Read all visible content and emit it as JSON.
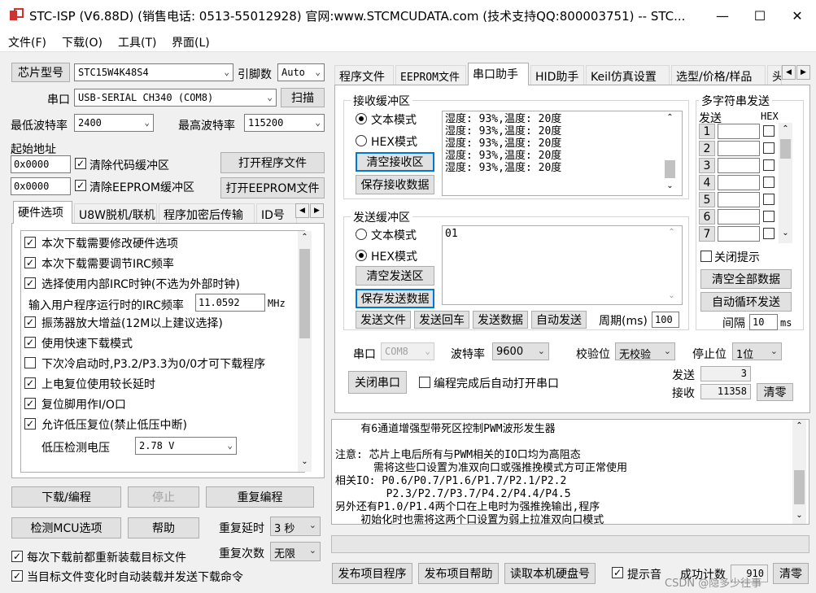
{
  "window": {
    "title": "STC-ISP (V6.88D) (销售电话: 0513-55012928) 官网:www.STCMCUDATA.com  (技术支持QQ:800003751) -- STC...",
    "minimize": "—",
    "maximize": "☐",
    "close": "✕"
  },
  "menu": [
    "文件(F)",
    "下载(O)",
    "工具(T)",
    "界面(L)"
  ],
  "left": {
    "chip_btn": "芯片型号",
    "chip_value": "STC15W4K48S4",
    "pins_label": "引脚数",
    "pins_value": "Auto",
    "port_label": "串口",
    "port_value": "USB-SERIAL CH340 (COM8)",
    "scan_btn": "扫描",
    "min_baud_label": "最低波特率",
    "min_baud_value": "2400",
    "max_baud_label": "最高波特率",
    "max_baud_value": "115200",
    "start_addr_label": "起始地址",
    "addr1": "0x0000",
    "clear_code": "清除代码缓冲区",
    "open_prog": "打开程序文件",
    "addr2": "0x0000",
    "clear_eeprom": "清除EEPROM缓冲区",
    "open_eeprom": "打开EEPROM文件",
    "tabs": [
      "硬件选项",
      "U8W脱机/联机",
      "程序加密后传输",
      "ID号"
    ],
    "options": [
      "本次下载需要修改硬件选项",
      "本次下载需要调节IRC频率",
      "选择使用内部IRC时钟(不选为外部时钟)"
    ],
    "irc_label": "输入用户程序运行时的IRC频率",
    "irc_value": "11.0592",
    "irc_unit": "MHz",
    "options2": [
      {
        "text": "振荡器放大增益(12M以上建议选择)",
        "checked": true
      },
      {
        "text": "使用快速下载模式",
        "checked": true
      },
      {
        "text": "下次冷启动时,P3.2/P3.3为0/0才可下载程序",
        "checked": false
      },
      {
        "text": "上电复位使用较长延时",
        "checked": true
      },
      {
        "text": "复位脚用作I/O口",
        "checked": true
      },
      {
        "text": "允许低压复位(禁止低压中断)",
        "checked": true
      }
    ],
    "lv_label": "低压检测电压",
    "lv_value": "2.78 V",
    "download_btn": "下载/编程",
    "stop_btn": "停止",
    "repeat_btn": "重复编程",
    "check_mcu_btn": "检测MCU选项",
    "help_btn": "帮助",
    "repeat_delay_label": "重复延时",
    "repeat_delay_value": "3 秒",
    "repeat_count_label": "重复次数",
    "repeat_count_value": "无限",
    "reload_chk": "每次下载前都重新装载目标文件",
    "auto_chk": "当目标文件变化时自动装载并发送下载命令"
  },
  "right": {
    "tabs": [
      "程序文件",
      "EEPROM文件",
      "串口助手",
      "HID助手",
      "Keil仿真设置",
      "选型/价格/样品",
      "头"
    ],
    "recv_group": "接收缓冲区",
    "recv_text_mode": "文本模式",
    "recv_hex_mode": "HEX模式",
    "clear_recv": "清空接收区",
    "save_recv": "保存接收数据",
    "recv_lines": [
      "湿度: 93%,温度: 20度",
      "湿度: 93%,温度: 20度",
      "湿度: 93%,温度: 20度",
      "湿度: 93%,温度: 20度",
      "湿度: 93%,温度: 20度"
    ],
    "send_group": "发送缓冲区",
    "send_text_mode": "文本模式",
    "send_hex_mode": "HEX模式",
    "clear_send": "清空发送区",
    "save_send": "保存发送数据",
    "send_content": "01",
    "send_file": "发送文件",
    "send_back": "发送回车",
    "send_data": "发送数据",
    "auto_send": "自动发送",
    "period_label": "周期(ms)",
    "period_value": "100",
    "multi_group": "多字符串发送",
    "multi_send_hdr": "发送",
    "multi_hex_hdr": "HEX",
    "multi_rows": [
      "1",
      "2",
      "3",
      "4",
      "5",
      "6",
      "7"
    ],
    "close_hint": "关闭提示",
    "clear_all": "清空全部数据",
    "auto_loop": "自动循环发送",
    "interval_label": "间隔",
    "interval_value": "10",
    "interval_unit": "ms",
    "port_label": "串口",
    "port_value": "COM8",
    "baud_label": "波特率",
    "baud_value": "9600",
    "parity_label": "校验位",
    "parity_value": "无校验",
    "stop_label": "停止位",
    "stop_value": "1位",
    "close_port": "关闭串口",
    "auto_open": "编程完成后自动打开串口",
    "send_count_label": "发送",
    "send_count": "3",
    "recv_count_label": "接收",
    "recv_count": "11358",
    "clear_count": "清零",
    "info_lines": [
      "    有6通道增强型带死区控制PWM波形发生器",
      "",
      "注意: 芯片上电后所有与PWM相关的IO口均为高阻态",
      "      需将这些口设置为准双向口或强推挽模式方可正常使用",
      "相关IO: P0.6/P0.7/P1.6/P1.7/P2.1/P2.2",
      "        P2.3/P2.7/P3.7/P4.2/P4.4/P4.5",
      "另外还有P1.0/P1.4两个口在上电时为强推挽输出,程序",
      "    初始化时也需将这两个口设置为弱上拉准双向口模式"
    ],
    "publish_prog": "发布项目程序",
    "publish_help": "发布项目帮助",
    "read_disk": "读取本机硬盘号",
    "beep_label": "提示音",
    "success_label": "成功计数",
    "success_value": "910",
    "clear_btn": "清零",
    "watermark": "CSDN @隐多少往事"
  }
}
